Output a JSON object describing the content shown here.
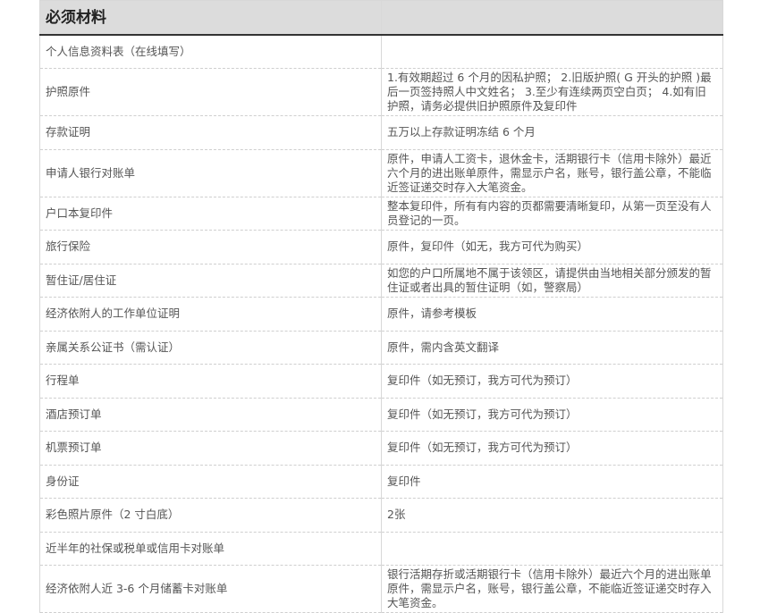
{
  "header": {
    "title": "必须材料",
    "second": ""
  },
  "rows": [
    {
      "item": "个人信息资料表（在线填写）",
      "desc": ""
    },
    {
      "item": "护照原件",
      "desc": "1.有效期超过 6 个月的因私护照； 2.旧版护照( G 开头的护照 )最后一页签持照人中文姓名； 3.至少有连续两页空白页； 4.如有旧护照，请务必提供旧护照原件及复印件"
    },
    {
      "item": "存款证明",
      "desc": "五万以上存款证明冻结 6 个月"
    },
    {
      "item": "申请人银行对账单",
      "desc": "原件，申请人工资卡，退休金卡，活期银行卡（信用卡除外）最近六个月的进出账单原件，需显示户名，账号，银行盖公章，不能临近签证递交时存入大笔资金。"
    },
    {
      "item": "户口本复印件",
      "desc": "整本复印件，所有有内容的页都需要清晰复印，从第一页至没有人员登记的一页。"
    },
    {
      "item": "旅行保险",
      "desc": "原件，复印件（如无，我方可代为购买）"
    },
    {
      "item": "暂住证/居住证",
      "desc": "如您的户口所属地不属于该领区，请提供由当地相关部分颁发的暂住证或者出具的暂住证明（如，警察局）"
    },
    {
      "item": "经济依附人的工作单位证明",
      "desc": "原件，请参考模板"
    },
    {
      "item": "亲属关系公证书（需认证）",
      "desc": "原件，需内含英文翻译"
    },
    {
      "item": "行程单",
      "desc": "复印件（如无预订，我方可代为预订）"
    },
    {
      "item": "酒店预订单",
      "desc": "复印件（如无预订，我方可代为预订）"
    },
    {
      "item": "机票预订单",
      "desc": "复印件（如无预订，我方可代为预订）"
    },
    {
      "item": "身份证",
      "desc": "复印件"
    },
    {
      "item": "彩色照片原件（2 寸白底）",
      "desc": "2张"
    },
    {
      "item": "近半年的社保或税单或信用卡对账单",
      "desc": ""
    },
    {
      "item": "经济依附人近 3-6 个月储蓄卡对账单",
      "desc": "银行活期存折或活期银行卡（信用卡除外）最近六个月的进出账单原件，需显示户名，账号，银行盖公章，不能临近签证递交时存入大笔资金。"
    }
  ]
}
